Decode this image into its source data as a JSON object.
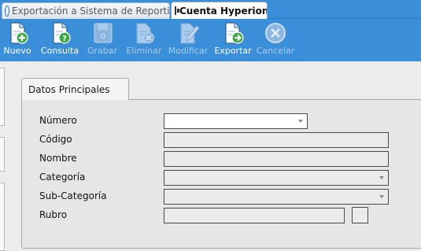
{
  "tabs": [
    {
      "label": "Exportación a Sistema de Reporting",
      "active": false,
      "icon": "globe-icon"
    },
    {
      "label": "Cuenta Hyperion",
      "active": true,
      "icon": "form-window-icon"
    }
  ],
  "toolbar": {
    "nuevo": "Nuevo",
    "consulta": "Consulta",
    "grabar": "Grabar",
    "eliminar": "Eliminar",
    "modificar": "Modificar",
    "exportar": "Exportar",
    "cancelar": "Cancelar"
  },
  "section": {
    "title": "Datos Principales"
  },
  "form": {
    "numero": {
      "label": "Número",
      "value": ""
    },
    "codigo": {
      "label": "Código",
      "value": ""
    },
    "nombre": {
      "label": "Nombre",
      "value": ""
    },
    "categoria": {
      "label": "Categoría",
      "value": ""
    },
    "subcategoria": {
      "label": "Sub-Categoría",
      "value": ""
    },
    "rubro": {
      "label": "Rubro",
      "value": ""
    }
  },
  "colors": {
    "toolbar_bg": "#3a8fd8",
    "enabled_label": "#ffffff",
    "disabled_label": "#a9cbee"
  }
}
